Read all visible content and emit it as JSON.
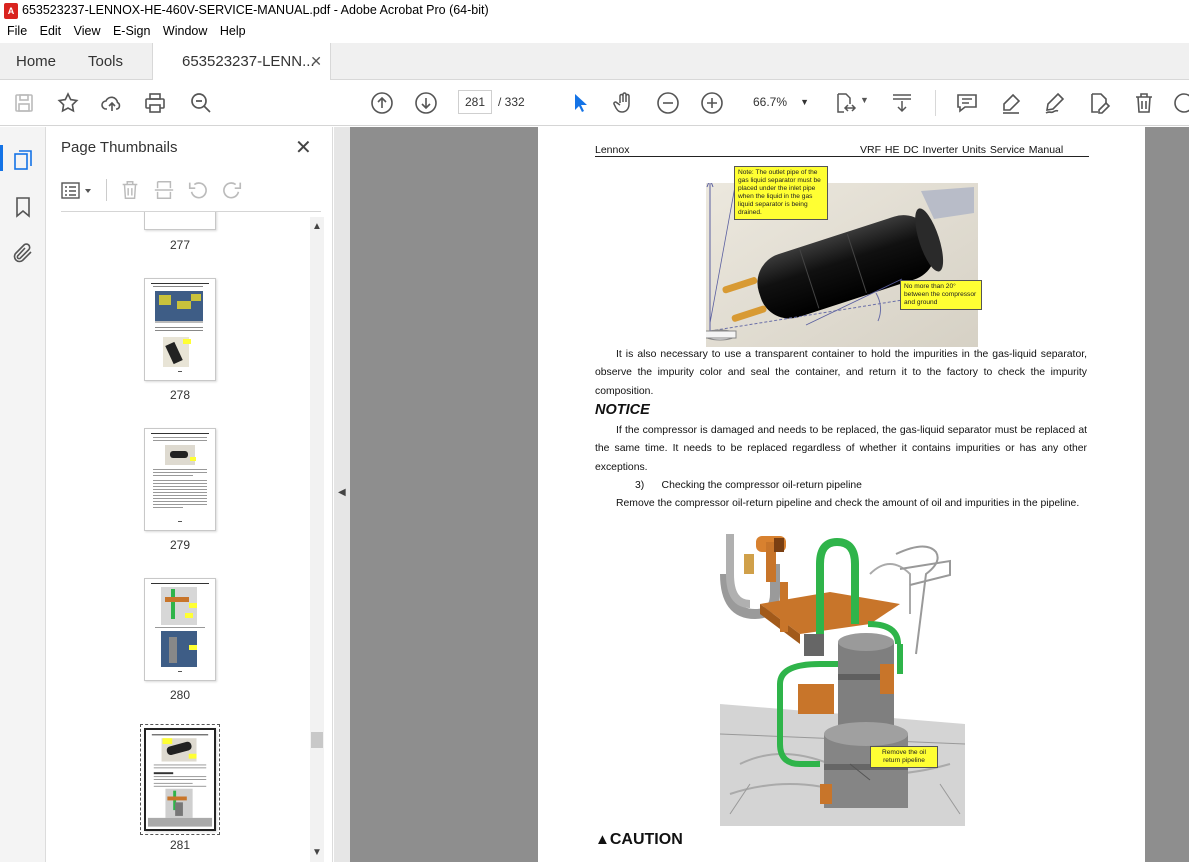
{
  "window": {
    "title": "653523237-LENNOX-HE-460V-SERVICE-MANUAL.pdf - Adobe Acrobat Pro (64-bit)"
  },
  "menu": [
    "File",
    "Edit",
    "View",
    "E-Sign",
    "Window",
    "Help"
  ],
  "tabs": {
    "home": "Home",
    "tools": "Tools",
    "doc": "653523237-LENN..."
  },
  "toolbar": {
    "current_page": "281",
    "total_pages": "/  332",
    "zoom": "66.7%"
  },
  "panel": {
    "title": "Page Thumbnails",
    "thumbnails": [
      {
        "label": "277"
      },
      {
        "label": "278"
      },
      {
        "label": "279"
      },
      {
        "label": "280"
      },
      {
        "label": "281"
      }
    ]
  },
  "document": {
    "header_left": "Lennox",
    "header_right": "VRF HE DC Inverter   Units Service Manual",
    "callout_1": "Note: The outlet pipe of the gas liquid separator must be placed under the inlet pipe when the liquid in the gas liquid separator is being drained.",
    "callout_2": "No more than 20° between the compressor and ground",
    "para_1": "It is also necessary to use a transparent container to hold the impurities in the gas-liquid separator, observe the impurity color and seal the container, and return it to the factory to check the impurity composition.",
    "notice": "NOTICE",
    "para_2": "If the compressor is damaged and needs to be replaced, the gas-liquid separator must be replaced at the same time. It needs to be replaced regardless of whether it contains impurities or has any other exceptions.",
    "step_3": "3)      Checking the compressor oil-return pipeline",
    "para_3": "Remove the compressor oil-return pipeline and check the amount of oil and impurities in the pipeline.",
    "callout_3": "Remove the oil return pipeline",
    "caution": "CAUTION"
  },
  "colors": {
    "accent": "#1473e6",
    "callout": "#ffff33",
    "pipe_green": "#2fb44a",
    "copper": "#c8752a"
  }
}
